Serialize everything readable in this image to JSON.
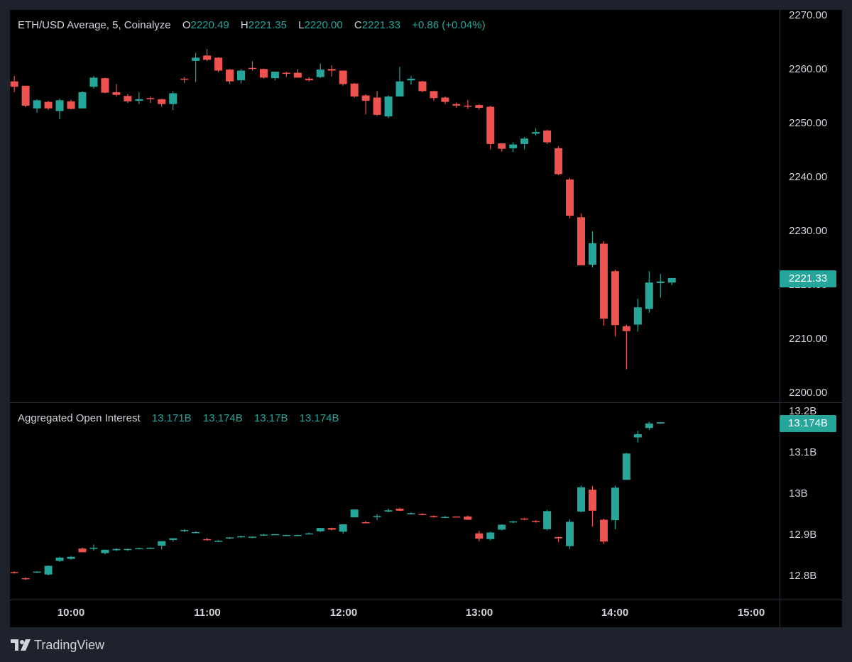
{
  "colors": {
    "up": "#26a69a",
    "down": "#ef5350",
    "background": "#000000",
    "frame": "#1e222d",
    "text": "#d1d4dc",
    "grid": "#2a2e39"
  },
  "price_legend": {
    "title": "ETH/USD Average, 5, Coinalyze",
    "o_label": "O",
    "o_value": "2220.49",
    "h_label": "H",
    "h_value": "2221.35",
    "l_label": "L",
    "l_value": "2220.00",
    "c_label": "C",
    "c_value": "2221.33",
    "change": "+0.86 (+0.04%)"
  },
  "oi_legend": {
    "title": "Aggregated Open Interest",
    "o_value": "13.171B",
    "h_value": "13.174B",
    "l_value": "13.17B",
    "c_value": "13.174B"
  },
  "price_axis": [
    "2270.00",
    "2260.00",
    "2250.00",
    "2240.00",
    "2230.00",
    "2220.00",
    "2210.00",
    "2200.00"
  ],
  "price_last_tag": "2221.33",
  "oi_axis": [
    "13.2B",
    "13.1B",
    "13B",
    "12.9B",
    "12.8B"
  ],
  "oi_last_tag": "13.174B",
  "time_axis": [
    "10:00",
    "11:00",
    "12:00",
    "13:00",
    "14:00",
    "15:00"
  ],
  "brand": "TradingView",
  "chart_data": [
    {
      "type": "candlestick",
      "title": "ETH/USD Average, 5, Coinalyze",
      "interval_minutes": 5,
      "x_start": "09:35",
      "ylim": [
        2200,
        2270
      ],
      "ohlc": [
        [
          2257.8,
          2258.8,
          2255.8,
          2256.8
        ],
        [
          2257.0,
          2257.0,
          2253.0,
          2253.3
        ],
        [
          2252.8,
          2254.5,
          2252.0,
          2254.3
        ],
        [
          2254.0,
          2254.2,
          2252.5,
          2252.8
        ],
        [
          2252.3,
          2254.6,
          2250.8,
          2254.3
        ],
        [
          2254.1,
          2254.4,
          2252.6,
          2252.7
        ],
        [
          2252.8,
          2256.0,
          2252.8,
          2255.8
        ],
        [
          2256.8,
          2258.8,
          2256.5,
          2258.5
        ],
        [
          2258.4,
          2258.5,
          2255.6,
          2255.7
        ],
        [
          2255.8,
          2257.3,
          2255.0,
          2255.3
        ],
        [
          2255.1,
          2255.5,
          2253.8,
          2254.1
        ],
        [
          2254.2,
          2255.8,
          2253.6,
          2254.5
        ],
        [
          2254.7,
          2255.0,
          2253.8,
          2254.5
        ],
        [
          2254.5,
          2254.6,
          2253.1,
          2253.6
        ],
        [
          2253.6,
          2256.0,
          2252.5,
          2255.6
        ],
        [
          2258.3,
          2258.6,
          2257.5,
          2258.2
        ],
        [
          2261.6,
          2263.1,
          2257.7,
          2262.2
        ],
        [
          2262.6,
          2263.8,
          2261.6,
          2261.8
        ],
        [
          2262.2,
          2262.3,
          2259.5,
          2259.8
        ],
        [
          2260.0,
          2260.1,
          2257.3,
          2257.8
        ],
        [
          2258.0,
          2260.1,
          2257.4,
          2259.8
        ],
        [
          2260.3,
          2261.5,
          2259.8,
          2260.1
        ],
        [
          2260.1,
          2260.2,
          2258.3,
          2258.5
        ],
        [
          2258.4,
          2259.6,
          2258.0,
          2259.6
        ],
        [
          2259.4,
          2259.6,
          2258.6,
          2259.3
        ],
        [
          2259.4,
          2260.1,
          2258.9,
          2258.5
        ],
        [
          2258.3,
          2258.6,
          2257.8,
          2258.0
        ],
        [
          2258.6,
          2261.1,
          2258.4,
          2260.0
        ],
        [
          2260.1,
          2260.8,
          2258.7,
          2259.8
        ],
        [
          2259.8,
          2259.8,
          2257.0,
          2257.3
        ],
        [
          2257.4,
          2257.5,
          2254.8,
          2255.0
        ],
        [
          2255.2,
          2255.4,
          2251.7,
          2254.2
        ],
        [
          2254.8,
          2256.0,
          2251.4,
          2251.6
        ],
        [
          2251.3,
          2255.2,
          2251.0,
          2255.0
        ],
        [
          2255.0,
          2260.5,
          2255.0,
          2257.8
        ],
        [
          2258.0,
          2258.8,
          2257.2,
          2258.3
        ],
        [
          2257.8,
          2257.9,
          2255.8,
          2256.0
        ],
        [
          2256.0,
          2256.1,
          2254.2,
          2254.7
        ],
        [
          2254.8,
          2255.0,
          2253.6,
          2254.0
        ],
        [
          2253.6,
          2253.9,
          2252.9,
          2253.3
        ],
        [
          2253.3,
          2254.3,
          2252.7,
          2253.2
        ],
        [
          2253.4,
          2253.6,
          2252.6,
          2252.9
        ],
        [
          2253.1,
          2253.3,
          2245.2,
          2246.2
        ],
        [
          2246.3,
          2246.3,
          2244.8,
          2245.3
        ],
        [
          2245.4,
          2246.5,
          2244.7,
          2246.1
        ],
        [
          2246.2,
          2247.5,
          2245.2,
          2247.2
        ],
        [
          2248.1,
          2249.1,
          2247.8,
          2248.4
        ],
        [
          2248.7,
          2248.8,
          2246.2,
          2246.5
        ],
        [
          2245.4,
          2245.8,
          2240.4,
          2240.6
        ],
        [
          2239.6,
          2239.9,
          2232.4,
          2232.9
        ],
        [
          2232.6,
          2233.3,
          2226.2,
          2223.7
        ],
        [
          2223.8,
          2230.0,
          2223.3,
          2227.8
        ],
        [
          2227.7,
          2228.2,
          2212.5,
          2213.8
        ],
        [
          2222.6,
          2222.9,
          2210.5,
          2212.6
        ],
        [
          2212.4,
          2212.7,
          2204.4,
          2211.5
        ],
        [
          2212.7,
          2217.5,
          2211.4,
          2215.9
        ],
        [
          2215.6,
          2222.6,
          2214.9,
          2220.5
        ],
        [
          2220.4,
          2222.1,
          2217.7,
          2220.7
        ],
        [
          2220.49,
          2221.35,
          2220.0,
          2221.33
        ]
      ]
    },
    {
      "type": "candlestick",
      "title": "Aggregated Open Interest",
      "interval_minutes": 5,
      "x_start": "09:35",
      "ylim": [
        12.77,
        13.22
      ],
      "unit": "B",
      "ohlc": [
        [
          12.81,
          12.812,
          12.806,
          12.809
        ],
        [
          12.795,
          12.797,
          12.791,
          12.794
        ],
        [
          12.81,
          12.812,
          12.808,
          12.811
        ],
        [
          12.804,
          12.826,
          12.802,
          12.825
        ],
        [
          12.837,
          12.847,
          12.835,
          12.845
        ],
        [
          12.842,
          12.849,
          12.84,
          12.847
        ],
        [
          12.867,
          12.869,
          12.858,
          12.858
        ],
        [
          12.868,
          12.877,
          12.862,
          12.869
        ],
        [
          12.856,
          12.865,
          12.853,
          12.864
        ],
        [
          12.863,
          12.868,
          12.861,
          12.866
        ],
        [
          12.864,
          12.867,
          12.861,
          12.866
        ],
        [
          12.867,
          12.869,
          12.865,
          12.868
        ],
        [
          12.868,
          12.87,
          12.866,
          12.869
        ],
        [
          12.874,
          12.885,
          12.865,
          12.885
        ],
        [
          12.888,
          12.892,
          12.884,
          12.892
        ],
        [
          12.91,
          12.914,
          12.907,
          12.912
        ],
        [
          12.905,
          12.909,
          12.905,
          12.907
        ],
        [
          12.89,
          12.893,
          12.886,
          12.889
        ],
        [
          12.885,
          12.888,
          12.883,
          12.886
        ],
        [
          12.892,
          12.895,
          12.89,
          12.894
        ],
        [
          12.896,
          12.898,
          12.893,
          12.897
        ],
        [
          12.896,
          12.896,
          12.892,
          12.896
        ],
        [
          12.9,
          12.903,
          12.898,
          12.901
        ],
        [
          12.902,
          12.902,
          12.9,
          12.902
        ],
        [
          12.9,
          12.901,
          12.898,
          12.9
        ],
        [
          12.9,
          12.901,
          12.898,
          12.9
        ],
        [
          12.904,
          12.906,
          12.902,
          12.904
        ],
        [
          12.909,
          12.917,
          12.907,
          12.917
        ],
        [
          12.917,
          12.918,
          12.911,
          12.913
        ],
        [
          12.908,
          12.926,
          12.903,
          12.926
        ],
        [
          12.943,
          12.961,
          12.943,
          12.962
        ],
        [
          12.931,
          12.934,
          12.928,
          12.929
        ],
        [
          12.945,
          12.951,
          12.936,
          12.946
        ],
        [
          12.957,
          12.964,
          12.955,
          12.96
        ],
        [
          12.964,
          12.966,
          12.958,
          12.959
        ],
        [
          12.953,
          12.955,
          12.95,
          12.953
        ],
        [
          12.951,
          12.953,
          12.949,
          12.95
        ],
        [
          12.946,
          12.948,
          12.942,
          12.945
        ],
        [
          12.944,
          12.946,
          12.941,
          12.944
        ],
        [
          12.945,
          12.945,
          12.943,
          12.944
        ],
        [
          12.945,
          12.947,
          12.937,
          12.937
        ],
        [
          12.904,
          12.91,
          12.885,
          12.891
        ],
        [
          12.89,
          12.908,
          12.887,
          12.906
        ],
        [
          12.913,
          12.926,
          12.911,
          12.925
        ],
        [
          12.932,
          12.935,
          12.929,
          12.933
        ],
        [
          12.94,
          12.942,
          12.936,
          12.938
        ],
        [
          12.934,
          12.936,
          12.93,
          12.933
        ],
        [
          12.914,
          12.961,
          12.911,
          12.958
        ],
        [
          12.895,
          12.896,
          12.883,
          12.892
        ],
        [
          12.873,
          12.938,
          12.866,
          12.932
        ],
        [
          12.957,
          13.02,
          12.955,
          13.016
        ],
        [
          13.01,
          13.019,
          12.92,
          12.959
        ],
        [
          12.937,
          12.94,
          12.878,
          12.884
        ],
        [
          12.936,
          13.02,
          12.914,
          13.015
        ],
        [
          13.034,
          13.1,
          13.034,
          13.098
        ],
        [
          13.137,
          13.153,
          13.125,
          13.145
        ],
        [
          13.16,
          13.175,
          13.155,
          13.171
        ],
        [
          13.171,
          13.174,
          13.17,
          13.174
        ]
      ]
    }
  ]
}
